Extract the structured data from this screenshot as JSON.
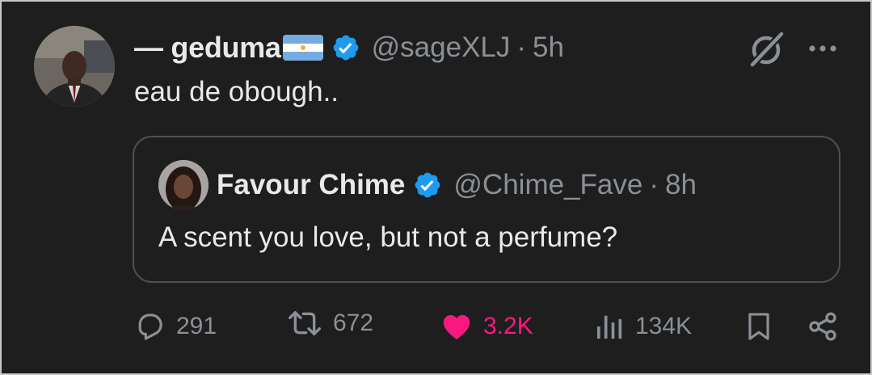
{
  "tweet": {
    "display_name": "— geduma",
    "flag_icon": "argentina-flag-icon",
    "verified_icon": "verified-badge-icon",
    "handle": "@sageXLJ",
    "separator": "·",
    "time": "5h",
    "text": "eau de obough..",
    "menu_icons": [
      "grok-icon",
      "more-icon"
    ]
  },
  "quote": {
    "display_name": "Favour Chime",
    "handle": "@Chime_Fave",
    "separator": "·",
    "time": "8h",
    "text": "A scent you love, but not a perfume?"
  },
  "actions": {
    "replies": {
      "icon": "reply-icon",
      "count": "291"
    },
    "reposts": {
      "icon": "repost-icon",
      "count": "672"
    },
    "likes": {
      "icon": "heart-icon",
      "count": "3.2K"
    },
    "views": {
      "icon": "analytics-icon",
      "count": "134K"
    },
    "bookmark": {
      "icon": "bookmark-icon"
    },
    "share": {
      "icon": "share-icon"
    }
  },
  "colors": {
    "background": "#1e1e1e",
    "text": "#e7e9ea",
    "muted": "#8b9096",
    "verified": "#1d9bf0",
    "like": "#f91880",
    "border": "#4d4f52"
  }
}
